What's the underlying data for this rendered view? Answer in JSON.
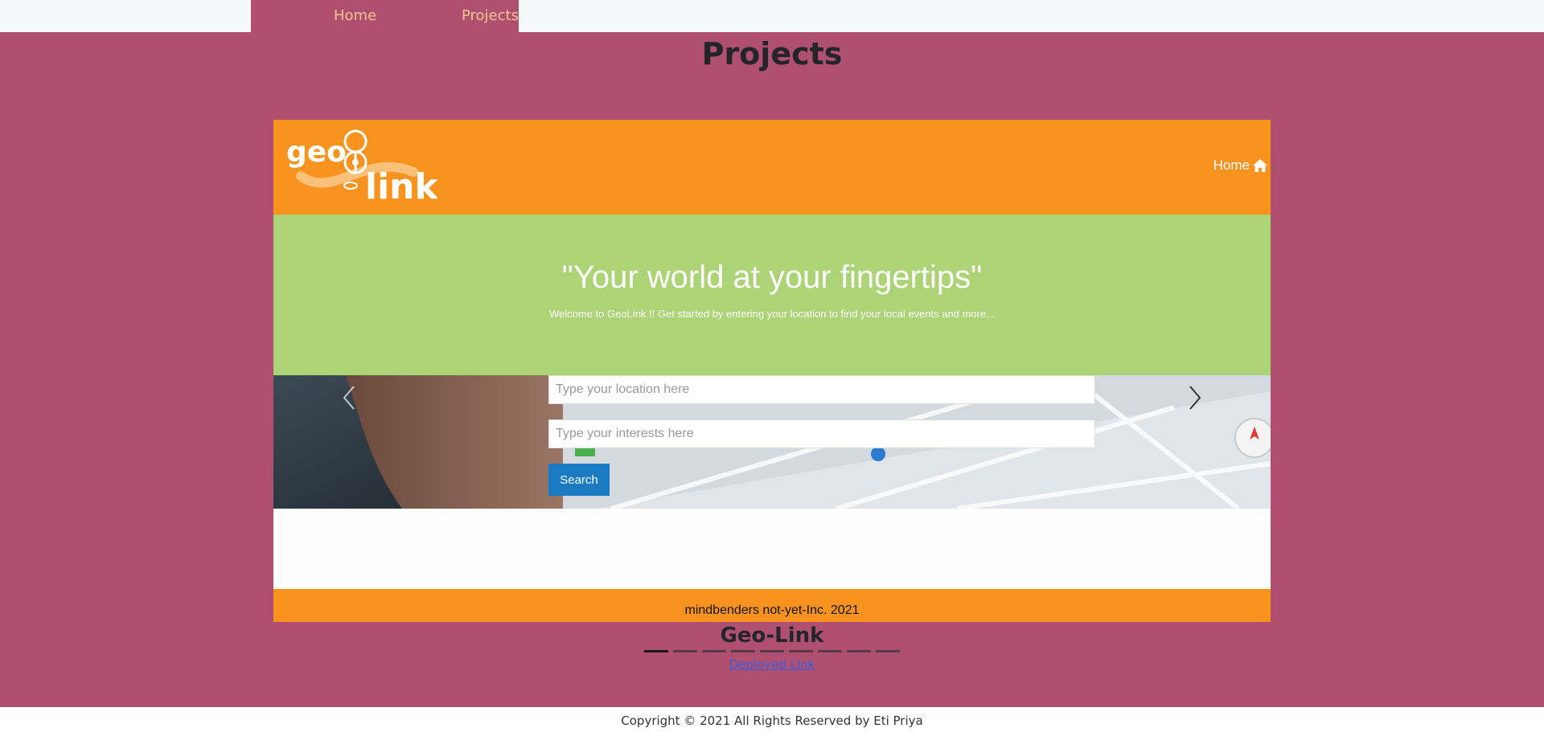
{
  "nav": {
    "home_label": "Home",
    "projects_label": "Projects"
  },
  "page": {
    "title": "Projects"
  },
  "project": {
    "header": {
      "logo_text_top": "geo",
      "logo_text_bottom": "link",
      "home_label": "Home"
    },
    "hero": {
      "tagline": "\"Your world at your fingertips\"",
      "welcome": "Welcome to GeoLink !! Get started by entering your location to find your local events and more..."
    },
    "search": {
      "location_placeholder": "Type your location here",
      "interests_placeholder": "Type your interests here",
      "button_label": "Search"
    },
    "footer_text": "mindbenders not-yet-Inc. 2021",
    "name": "Geo-Link",
    "deployed_link_label": "Deployed Link"
  },
  "carousel": {
    "indicator_count": 9,
    "active_index": 0
  },
  "footer": {
    "copyright": "Copyright © 2021 All Rights Reserved by Eti Priya"
  },
  "colors": {
    "page_background": "#b05070",
    "nav_text": "#f3c48c",
    "geolink_orange": "#f7931e",
    "geolink_green": "#acd476",
    "search_button": "#1a7bc2"
  },
  "icons": [
    "home-icon",
    "chevron-left-icon",
    "chevron-right-icon",
    "map-pin-icon"
  ]
}
